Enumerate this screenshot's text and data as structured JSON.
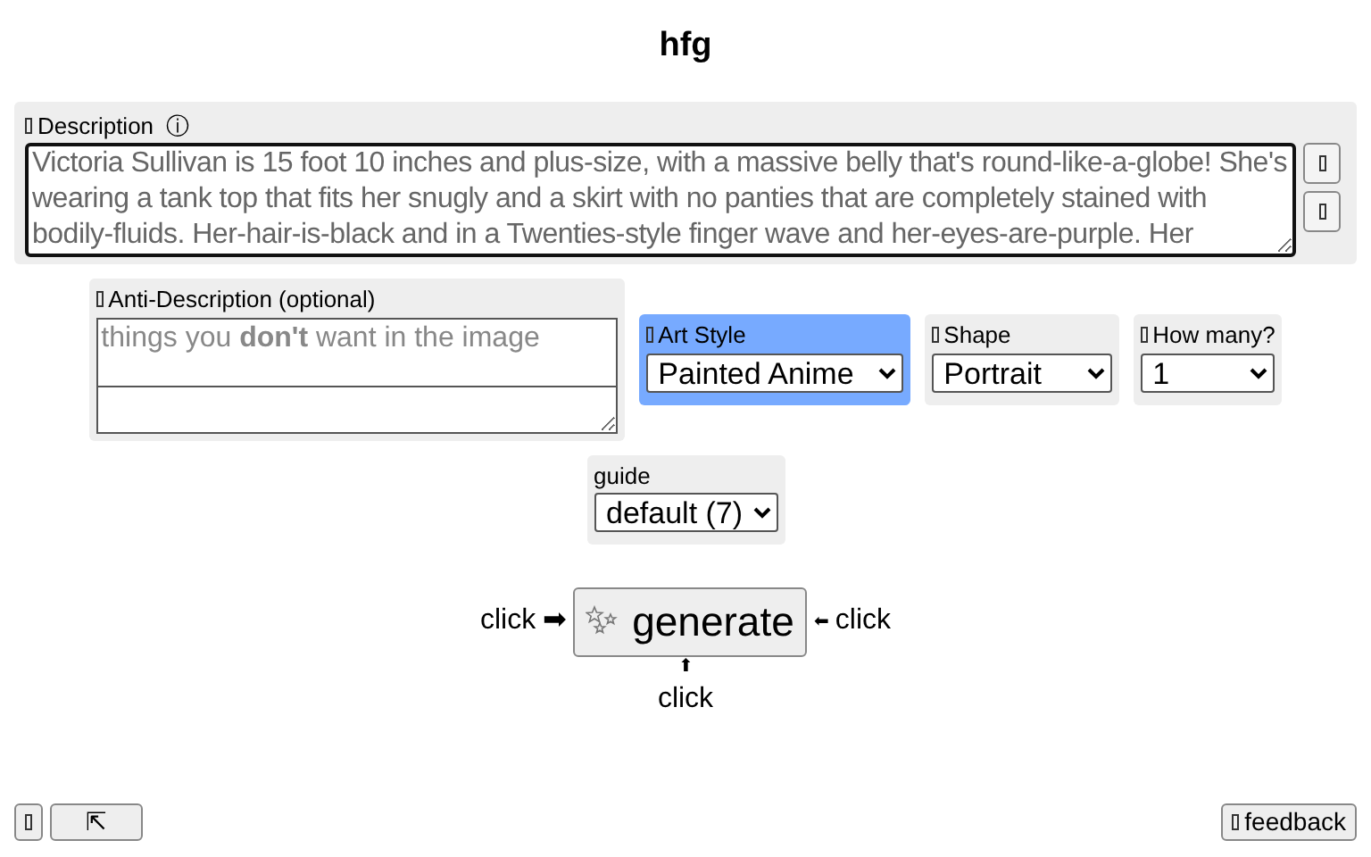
{
  "title": "hfg",
  "description": {
    "label": "Description",
    "info": "ⓘ",
    "value": "Victoria Sullivan is 15 foot 10 inches and plus-size, with a massive belly that's round-like-a-globe! She's wearing a tank top that fits her snugly and a skirt with no panties that are completely stained with bodily-fluids. Her-hair-is-black and in a Twenties-style finger wave and her-eyes-are-purple. Her"
  },
  "anti_description": {
    "label": "Anti-Description (optional)",
    "placeholder": "things you **don't** want in the image"
  },
  "options": [
    {
      "label": "Art Style",
      "value": "Painted Anime",
      "highlighted": true
    },
    {
      "label": "Shape",
      "value": "Portrait",
      "highlighted": false
    },
    {
      "label": "How many?",
      "value": "1",
      "highlighted": false
    }
  ],
  "guide": {
    "label": "guide",
    "value": "default (7)"
  },
  "generate": {
    "label": "generate",
    "left_hint": "click",
    "left_arrow": "➡",
    "right_arrow": "⬅",
    "right_hint": "click",
    "below_arrow": "⬆",
    "below_hint": "click"
  },
  "footer": {
    "top_button": "⇱",
    "feedback": "feedback"
  }
}
